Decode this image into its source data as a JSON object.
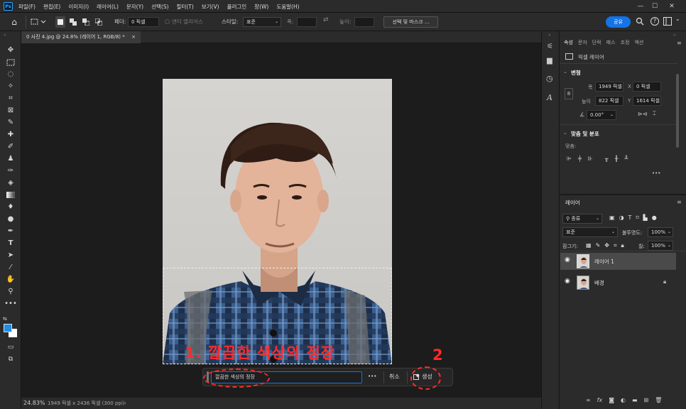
{
  "app": {
    "logo": "Ps"
  },
  "menu": [
    "파일(F)",
    "편집(E)",
    "이미지(I)",
    "레이어(L)",
    "문자(Y)",
    "선택(S)",
    "필터(T)",
    "보기(V)",
    "플러그인",
    "창(W)",
    "도움말(H)"
  ],
  "window_controls": {
    "minimize": "—",
    "maximize": "☐",
    "close": "✕"
  },
  "options": {
    "feather_label": "페더:",
    "feather_value": "0 픽셀",
    "antialias_label": "앤티 앨리어스",
    "style_label": "스타일:",
    "style_value": "표준",
    "width_label": "폭:",
    "height_label": "높이:",
    "select_mask_label": "선택 및 마스크 ...",
    "share_label": "공유"
  },
  "document": {
    "tab_title": "0 사진 4.jpg @ 24.8% (레이어 1, RGB/8) *",
    "close": "×"
  },
  "status": {
    "zoom": "24.83%",
    "info": "1949 픽셀 x 2436 픽셀 (300 ppi)",
    "arrow": "›"
  },
  "taskbar": {
    "prompt_value": "깔끔한 색상의 정장",
    "more": "•••",
    "cancel_label": "취소",
    "generate_label": "생성"
  },
  "annotations": {
    "step1": "1. 깔끔한 색상의 정장",
    "step2": "2"
  },
  "properties": {
    "tabs": [
      "속성",
      "문자",
      "단락",
      "패스",
      "조정",
      "액션"
    ],
    "layer_kind": "픽셀 레이어",
    "transform_header": "변형",
    "w_label": "폭",
    "w_value": "1949 픽셀",
    "x_label": "X",
    "x_value": "0 픽셀",
    "h_label": "높이",
    "h_value": "822 픽셀",
    "y_label": "Y",
    "y_value": "1614 픽셀",
    "angle_value": "0.00°",
    "align_header": "맞춤 및 분포",
    "align_label": "맞춤:",
    "more": "•••"
  },
  "layers": {
    "panel_title": "레이어",
    "filter_value": "종류",
    "blend_value": "표준",
    "opacity_label": "불투명도:",
    "opacity_value": "100%",
    "lock_label": "잠그기:",
    "fill_label": "칠:",
    "fill_value": "100%",
    "items": [
      {
        "name": "레이어 1",
        "selected": true
      },
      {
        "name": "배경",
        "locked": true
      }
    ]
  },
  "colors": {
    "accent": "#1473e6",
    "annotation": "#ff2a2a",
    "foreground": "#1f8fe6",
    "background": "#ffffff"
  }
}
